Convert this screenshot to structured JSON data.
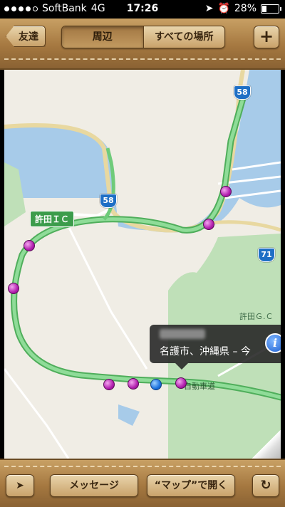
{
  "status": {
    "carrier": "SoftBank",
    "network": "4G",
    "time": "17:26",
    "battery": "28%",
    "battery_level": 0.28
  },
  "nav": {
    "back_label": "友達",
    "segments": [
      "周辺",
      "すべての場所"
    ],
    "active_segment": 0,
    "add_label": "+"
  },
  "map": {
    "ic_label": "許田ＩＣ",
    "route_shields": [
      "58",
      "58",
      "71"
    ],
    "golf_label": "許田Ｇ.Ｃ",
    "road_label": "自動車道",
    "callout": {
      "subtitle": "名護市、沖縄県 – 今",
      "info_glyph": "i"
    }
  },
  "toolbar": {
    "message_label": "メッセージ",
    "open_maps_label": "“マップ”で開く"
  },
  "colors": {
    "water": "#a7cbe9",
    "land": "#f0ede5",
    "park": "#bfe0b8",
    "route": "#6fcb7a"
  }
}
